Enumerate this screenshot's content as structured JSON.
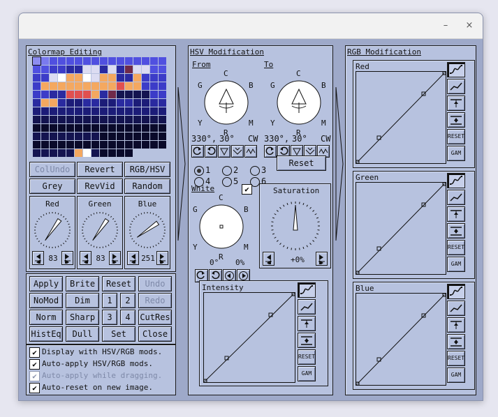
{
  "window": {
    "minimize_glyph": "–",
    "close_glyph": "×"
  },
  "colormap": {
    "title": "Colormap Editing",
    "palette": [
      "#0a0a2a",
      "#141450",
      "#1c1c78",
      "#2a2aa0",
      "#3c3cc8",
      "#5050e0",
      "#7a7aef",
      "#dcdcf2",
      "#ffffff",
      "#f4a860",
      "#e05050",
      "#702a4a",
      "#808080",
      "#2d2d3a"
    ],
    "cells": [
      "6655555555555555",
      "5544337737337755",
      "4477997799337444",
      "4499999999999444",
      "4433999933111144",
      "3333223322332233",
      "2222222222222222",
      "1111111111111111",
      "0000000000000000",
      "1111111100000000",
      "0000000000000000",
      "111111110000"
    ],
    "highlight": [
      {
        "row": 0,
        "col": 0,
        "color": "#8d8df0"
      },
      {
        "row": 2,
        "col": 3,
        "color": "#ffffff"
      },
      {
        "row": 2,
        "col": 6,
        "color": "#ffffff"
      },
      {
        "row": 2,
        "col": 8,
        "color": "#f4a860"
      },
      {
        "row": 2,
        "col": 9,
        "color": "#f4a860"
      },
      {
        "row": 2,
        "col": 12,
        "color": "#f4a860"
      },
      {
        "row": 3,
        "col": 1,
        "color": "#f4a860"
      },
      {
        "row": 3,
        "col": 4,
        "color": "#f4a860"
      },
      {
        "row": 3,
        "col": 7,
        "color": "#f4a860"
      },
      {
        "row": 3,
        "col": 10,
        "color": "#e05050"
      },
      {
        "row": 4,
        "col": 4,
        "color": "#e05050"
      },
      {
        "row": 4,
        "col": 5,
        "color": "#e05050"
      },
      {
        "row": 4,
        "col": 6,
        "color": "#e05050"
      },
      {
        "row": 4,
        "col": 9,
        "color": "#702a4a"
      },
      {
        "row": 1,
        "col": 11,
        "color": "#702a4a"
      },
      {
        "row": 11,
        "col": 5,
        "color": "#f4a860"
      },
      {
        "row": 11,
        "col": 6,
        "color": "#ffffff"
      },
      {
        "row": 5,
        "col": 1,
        "color": "#f4a860"
      },
      {
        "row": 5,
        "col": 2,
        "color": "#f4a860"
      }
    ],
    "buttons": [
      "ColUndo",
      "Revert",
      "RGB/HSV",
      "Grey",
      "RevVid",
      "Random"
    ],
    "dials": [
      {
        "label": "Red",
        "value": "83",
        "angle": -55
      },
      {
        "label": "Green",
        "value": "83",
        "angle": -55
      },
      {
        "label": "Blue",
        "value": "251",
        "angle": -35
      }
    ]
  },
  "controls": {
    "buttons": [
      "Apply",
      "Brite",
      "Reset",
      "Undo",
      "NoMod",
      "Dim",
      "1",
      "2",
      "Redo",
      "Norm",
      "Sharp",
      "3",
      "4",
      "CutRes",
      "HistEq",
      "Dull",
      "Set",
      "Close"
    ],
    "disabled": [
      "Undo",
      "Redo"
    ],
    "checkboxes": [
      {
        "label": "Display with HSV/RGB mods.",
        "checked": true,
        "disabled": false
      },
      {
        "label": "Auto-apply HSV/RGB mods.",
        "checked": true,
        "disabled": false
      },
      {
        "label": "Auto-apply while dragging.",
        "checked": true,
        "disabled": true
      },
      {
        "label": "Auto-reset on new image.",
        "checked": true,
        "disabled": false
      }
    ],
    "check_glyph": "✔"
  },
  "hsv": {
    "title": "HSV Modification",
    "from_label": "From",
    "to_label": "To",
    "wheel_letters": {
      "top": "C",
      "tl": "G",
      "tr": "B",
      "bl": "Y",
      "br": "M",
      "bottom": "R"
    },
    "from_values": {
      "a": "330°,",
      "b": "30°",
      "dir": "CW"
    },
    "to_values": {
      "a": "330°,",
      "b": "30°",
      "dir": "CW"
    },
    "radio_labels": [
      "1",
      "2",
      "3",
      "4",
      "5",
      "6"
    ],
    "reset_label": "Reset",
    "white_label": "White",
    "white_values": {
      "deg": "0°",
      "pct": "0%"
    },
    "saturation_label": "Saturation",
    "saturation_value": "+0%",
    "intensity_label": "Intensity"
  },
  "rgb": {
    "title": "RGB Modification",
    "channels": [
      "Red",
      "Green",
      "Blue"
    ]
  },
  "curve_buttons": {
    "reset": "RESET",
    "gam": "GAM"
  }
}
